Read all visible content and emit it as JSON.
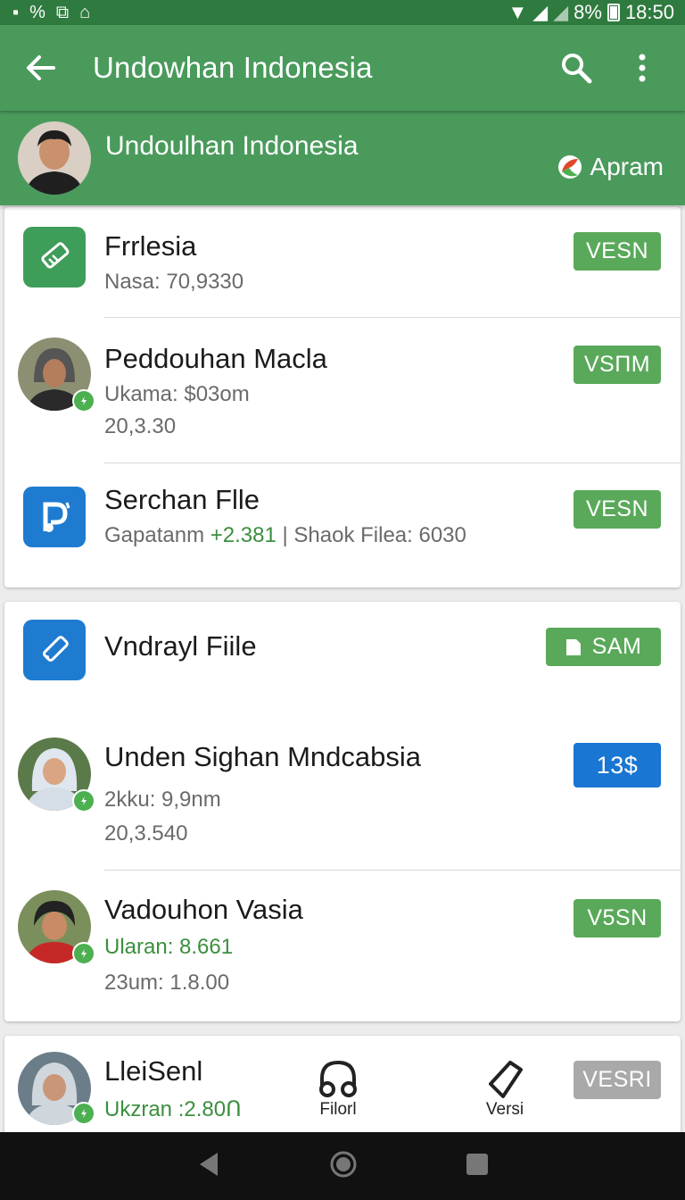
{
  "status_bar": {
    "battery": "8%",
    "time": "18:50"
  },
  "app_bar": {
    "title": "Undowhan Indonesia"
  },
  "profile_header": {
    "name": "Undoulhan Indonesia",
    "badge_label": "Apram"
  },
  "card1": {
    "items": [
      {
        "title": "Frrlesia",
        "line1": "Nasa: 70,9330",
        "action": "VESN"
      },
      {
        "title": "Peddouhan Macla",
        "line1": "Ukama: $03om",
        "line2": "20,3.30",
        "action": "VSΠM"
      },
      {
        "title": "Serchan Flle",
        "line1_prefix": "Gapatanm",
        "line1_green": "+2.381",
        "line1_suffix": "| Shaok Filea: 6030",
        "action": "VESN"
      }
    ]
  },
  "card2": {
    "items": [
      {
        "title": "Vndrayl Fiile",
        "action": "SAM"
      },
      {
        "title": "Unden Sighan Mndcabsia",
        "line1": "2kku: 9,9nm",
        "line2": "20,3.540",
        "action": "13$"
      },
      {
        "title": "Vadouhon Vasia",
        "line1": "Ularan: 8.661",
        "line2": "23um: 1.8.00",
        "action": "V5SN"
      }
    ]
  },
  "card3": {
    "items": [
      {
        "title": "LleiSenl",
        "line1": "Ukzran :2.80Ո",
        "action": "VESRI"
      }
    ],
    "bottom_actions": [
      {
        "label": "Filorl"
      },
      {
        "label": "Versi"
      }
    ]
  },
  "colors": {
    "primary": "#4a9a5c",
    "status": "#2f7a3f",
    "accent_green": "#5aa95a",
    "accent_blue": "#1976d2",
    "nav": "#111111"
  }
}
